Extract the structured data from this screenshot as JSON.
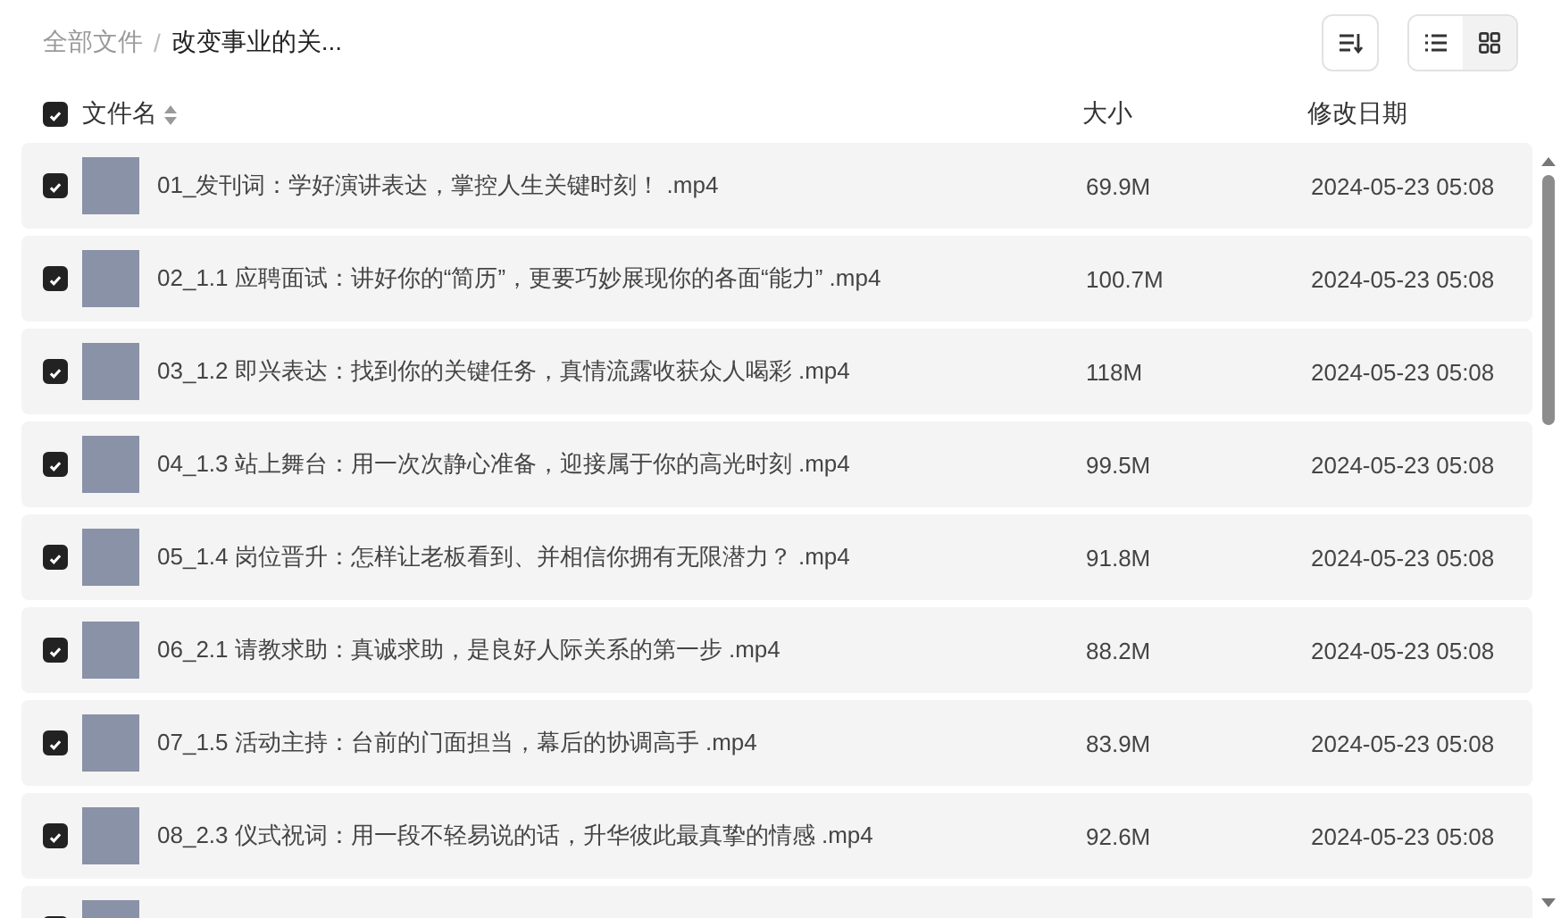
{
  "breadcrumb_separator": "/",
  "breadcrumb": [
    {
      "label": "全部文件",
      "current": false
    },
    {
      "label": "改变事业的关...",
      "current": true
    }
  ],
  "view_toggle": [
    {
      "kind": "list",
      "selected": true
    },
    {
      "kind": "grid",
      "selected": false
    }
  ],
  "header": {
    "checked": true,
    "columns": [
      "文件名",
      "大小",
      "修改日期"
    ]
  },
  "rows": [
    {
      "checked": true,
      "name": "01_发刊词：学好演讲表达，掌控人生关键时刻！ .mp4",
      "size": "69.9M",
      "date": "2024-05-23 05:08"
    },
    {
      "checked": true,
      "name": "02_1.1 应聘面试：讲好你的“简历”，更要巧妙展现你的各面“能力” .mp4",
      "size": "100.7M",
      "date": "2024-05-23 05:08"
    },
    {
      "checked": true,
      "name": "03_1.2 即兴表达：找到你的关键任务，真情流露收获众人喝彩 .mp4",
      "size": "118M",
      "date": "2024-05-23 05:08"
    },
    {
      "checked": true,
      "name": "04_1.3 站上舞台：用一次次静心准备，迎接属于你的高光时刻 .mp4",
      "size": "99.5M",
      "date": "2024-05-23 05:08"
    },
    {
      "checked": true,
      "name": "05_1.4 岗位晋升：怎样让老板看到、并相信你拥有无限潜力？ .mp4",
      "size": "91.8M",
      "date": "2024-05-23 05:08"
    },
    {
      "checked": true,
      "name": "06_2.1 请教求助：真诚求助，是良好人际关系的第一步 .mp4",
      "size": "88.2M",
      "date": "2024-05-23 05:08"
    },
    {
      "checked": true,
      "name": "07_1.5 活动主持：台前的门面担当，幕后的协调高手 .mp4",
      "size": "83.9M",
      "date": "2024-05-23 05:08"
    },
    {
      "checked": true,
      "name": "08_2.3 仪式祝词：用一段不轻易说的话，升华彼此最真挚的情感 .mp4",
      "size": "92.6M",
      "date": "2024-05-23 05:08"
    },
    {
      "checked": true
    }
  ]
}
